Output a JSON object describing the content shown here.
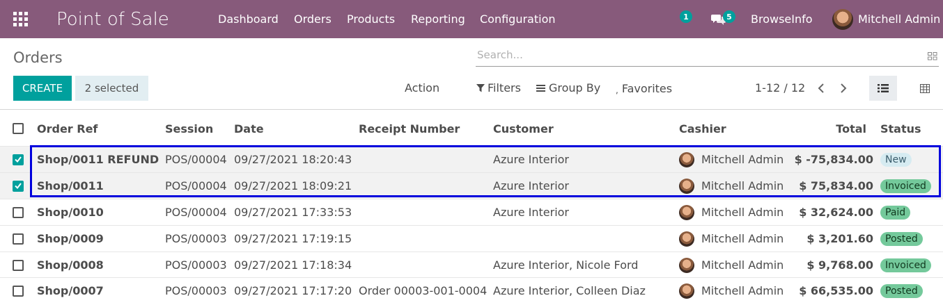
{
  "navbar": {
    "app_name": "Point of Sale",
    "menu": [
      "Dashboard",
      "Orders",
      "Products",
      "Reporting",
      "Configuration"
    ],
    "activity_count": "1",
    "messages_count": "5",
    "company": "BrowseInfo",
    "user": "Mitchell Admin",
    "color": "#875a7b"
  },
  "control_panel": {
    "breadcrumb": "Orders",
    "search_placeholder": "Search...",
    "create_label": "CREATE",
    "selected_label": "2 selected",
    "action_label": "Action",
    "filters_label": "Filters",
    "group_by_label": "Group By",
    "favorites_label": "Favorites",
    "pager_value": "1-12 / 12",
    "accent_color": "#00a09d"
  },
  "table": {
    "columns": {
      "order_ref": "Order Ref",
      "session": "Session",
      "date": "Date",
      "receipt": "Receipt Number",
      "customer": "Customer",
      "cashier": "Cashier",
      "total": "Total",
      "status": "Status"
    },
    "rows": [
      {
        "ref": "Shop/0011 REFUND",
        "session": "POS/00004",
        "date": "09/27/2021 18:20:43",
        "receipt": "",
        "customer": "Azure Interior",
        "cashier": "Mitchell Admin",
        "total": "$ -75,834.00",
        "status": "New",
        "selected": true
      },
      {
        "ref": "Shop/0011",
        "session": "POS/00004",
        "date": "09/27/2021 18:09:21",
        "receipt": "",
        "customer": "Azure Interior",
        "cashier": "Mitchell Admin",
        "total": "$ 75,834.00",
        "status": "Invoiced",
        "selected": true
      },
      {
        "ref": "Shop/0010",
        "session": "POS/00004",
        "date": "09/27/2021 17:33:53",
        "receipt": "",
        "customer": "Azure Interior",
        "cashier": "Mitchell Admin",
        "total": "$ 32,624.00",
        "status": "Paid",
        "selected": false
      },
      {
        "ref": "Shop/0009",
        "session": "POS/00003",
        "date": "09/27/2021 17:19:15",
        "receipt": "",
        "customer": "",
        "cashier": "Mitchell Admin",
        "total": "$ 3,201.60",
        "status": "Posted",
        "selected": false
      },
      {
        "ref": "Shop/0008",
        "session": "POS/00003",
        "date": "09/27/2021 17:18:34",
        "receipt": "",
        "customer": "Azure Interior, Nicole Ford",
        "cashier": "Mitchell Admin",
        "total": "$ 9,768.00",
        "status": "Invoiced",
        "selected": false
      },
      {
        "ref": "Shop/0007",
        "session": "POS/00003",
        "date": "09/27/2021 17:17:20",
        "receipt": "Order 00003-001-0004",
        "customer": "Azure Interior, Colleen Diaz",
        "cashier": "Mitchell Admin",
        "total": "$ 66,535.00",
        "status": "Posted",
        "selected": false
      }
    ]
  },
  "highlight_color": "#0000dd"
}
